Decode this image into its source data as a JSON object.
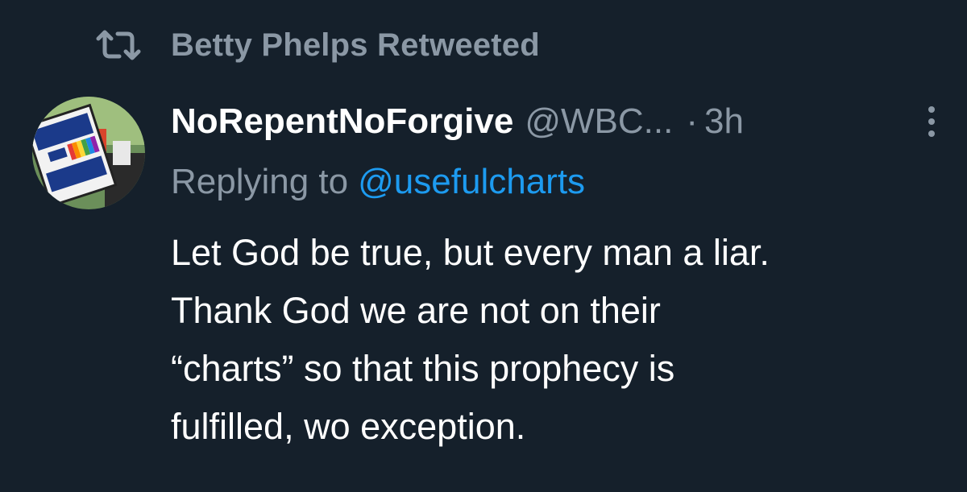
{
  "retweet": {
    "label": "Betty Phelps Retweeted",
    "icon": "retweet-icon"
  },
  "author": {
    "display_name": "NoRepentNoForgive",
    "handle": "@WBC...",
    "separator": "·",
    "time": "3h",
    "avatar_icon": "avatar-protest-sign"
  },
  "reply": {
    "prefix": "Replying to",
    "handle": "@usefulcharts"
  },
  "tweet": {
    "lines": [
      "Let God be true, but every man a liar.",
      "Thank God we are not on their",
      "“charts” so that this prophecy is",
      "fulfilled, wo exception."
    ]
  },
  "menu": {
    "icon": "more-vertical-icon"
  },
  "colors": {
    "background": "#15202b",
    "secondary_text": "#8b98a5",
    "link": "#1d9bf0",
    "primary_text": "#ffffff"
  }
}
